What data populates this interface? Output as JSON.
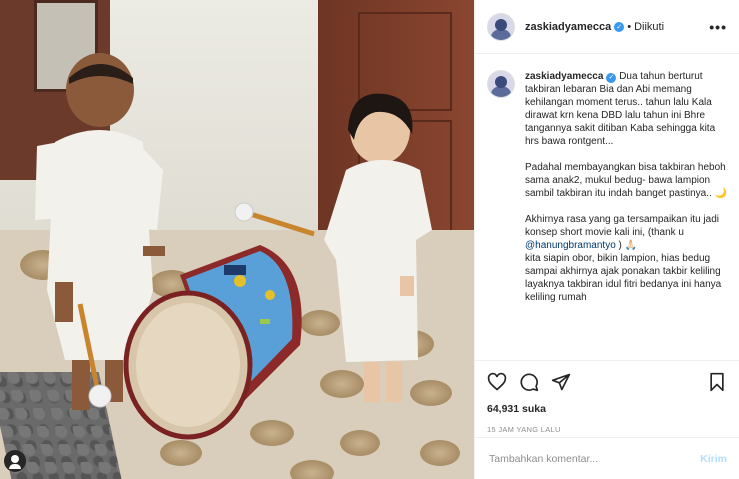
{
  "post": {
    "username": "zaskiadyamecca",
    "follow_state": "Diikuti",
    "separator": "•",
    "more_label": "•••"
  },
  "caption": {
    "username": "zaskiadyamecca",
    "text_1": "Dua tahun berturut takbiran lebaran Bia dan Abi memang kehilangan moment terus.. tahun lalu Kala dirawat krn kena DBD lalu tahun ini Bhre tangannya sakit ditiban Kaba sehingga kita hrs bawa rontgent...\n\nPadahal membayangkan bisa takbiran heboh sama anak2, mukul bedug- bawa lampion sambil takbiran itu indah banget pastinya.. 🌙\n\nAkhirnya rasa yang ga tersampaikan itu jadi konsep short movie kali ini, (thank u ",
    "mention": "@hanungbramantyo",
    "text_2": " ) 🙏🏻\nkita siapin obor, bikin lampion, hias bedug sampai akhirnya ajak ponakan takbir keliling layaknya takbiran idul fitri bedanya ini hanya keliling rumah"
  },
  "actions": {
    "like_icon": "heart-icon",
    "comment_icon": "comment-icon",
    "share_icon": "share-icon",
    "save_icon": "bookmark-icon",
    "likes": "64,931 suka",
    "timestamp": "15 JAM YANG LALU"
  },
  "comment_box": {
    "placeholder": "Tambahkan komentar...",
    "submit_label": "Kirim"
  },
  "colors": {
    "verified": "#3897f0",
    "send_disabled": "#b2dffc",
    "mention": "#00376b"
  }
}
